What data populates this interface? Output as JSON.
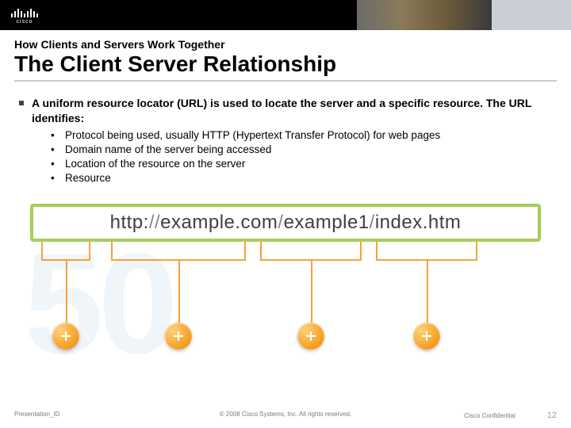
{
  "header": {
    "logo_text": "cisco"
  },
  "slide": {
    "pretitle": "How Clients and Servers Work Together",
    "title": "The Client Server Relationship",
    "main_bullet": "A uniform resource locator (URL) is used to locate the server and a specific resource. The URL identifies:",
    "sub_bullets": [
      "Protocol being used, usually HTTP (Hypertext Transfer Protocol) for web pages",
      "Domain name of the server being accessed",
      "Location of the resource on the server",
      "Resource"
    ]
  },
  "diagram": {
    "segments": {
      "protocol": "http:",
      "sep1": "//",
      "domain": "example.com",
      "sep2": "/",
      "path": "example1",
      "sep3": "/",
      "resource": "index.htm"
    }
  },
  "watermark": "50",
  "footer": {
    "left": "Presentation_ID",
    "center": "© 2008 Cisco Systems, Inc. All rights reserved.",
    "confidential": "Cisco Confidential",
    "page": "12"
  }
}
